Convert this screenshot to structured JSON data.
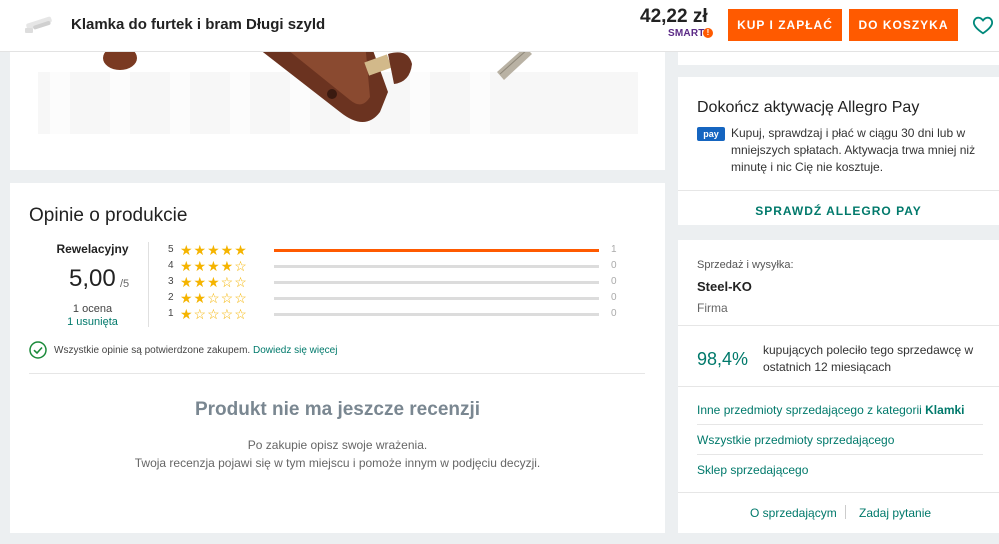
{
  "header": {
    "title": "Klamka do furtek i bram Długi szyld",
    "price": "42,22 zł",
    "smart": "SMART",
    "buy_label": "KUP I ZAPŁAĆ",
    "cart_label": "DO KOSZYKA",
    "accent": "#ff5a00"
  },
  "reviews": {
    "title": "Opinie o produkcie",
    "rating_word": "Rewelacyjny",
    "score": "5,00",
    "score_max": "/5",
    "count": "1 ocena",
    "removed": "1 usunięta",
    "rows": [
      {
        "stars": "5",
        "filled": 5,
        "count": "1",
        "fraction": 1.0
      },
      {
        "stars": "4",
        "filled": 4,
        "count": "0",
        "fraction": 0
      },
      {
        "stars": "3",
        "filled": 3,
        "count": "0",
        "fraction": 0
      },
      {
        "stars": "2",
        "filled": 2,
        "count": "0",
        "fraction": 0
      },
      {
        "stars": "1",
        "filled": 1,
        "count": "0",
        "fraction": 0
      }
    ],
    "verified_text": "Wszystkie opinie są potwierdzone zakupem.",
    "verified_link": "Dowiedz się więcej",
    "empty_title": "Produkt nie ma jeszcze recenzji",
    "empty_desc1": "Po zakupie opisz swoje wrażenia.",
    "empty_desc2": "Twoja recenzja pojawi się w tym miejscu i pomoże innym w podjęciu decyzji."
  },
  "pay": {
    "title": "Dokończ aktywację Allegro Pay",
    "badge": "pay",
    "desc": "Kupuj, sprawdzaj i płać w ciągu 30 dni lub w mniejszych spłatach. Aktywacja trwa mniej niż minutę i nic Cię nie kosztuje.",
    "link": "SPRAWDŹ ALLEGRO PAY"
  },
  "seller": {
    "label": "Sprzedaż i wysyłka:",
    "name": "Steel-KO",
    "type": "Firma",
    "percent": "98,4%",
    "percent_desc": "kupujących poleciło tego sprzedawcę w ostatnich 12 miesiącach",
    "link1_prefix": "Inne przedmioty sprzedającego z kategorii",
    "link1_cat": "Klamki",
    "link2": "Wszystkie przedmioty sprzedającego",
    "link3": "Sklep sprzedającego",
    "about": "O sprzedającym",
    "ask": "Zadaj pytanie"
  }
}
